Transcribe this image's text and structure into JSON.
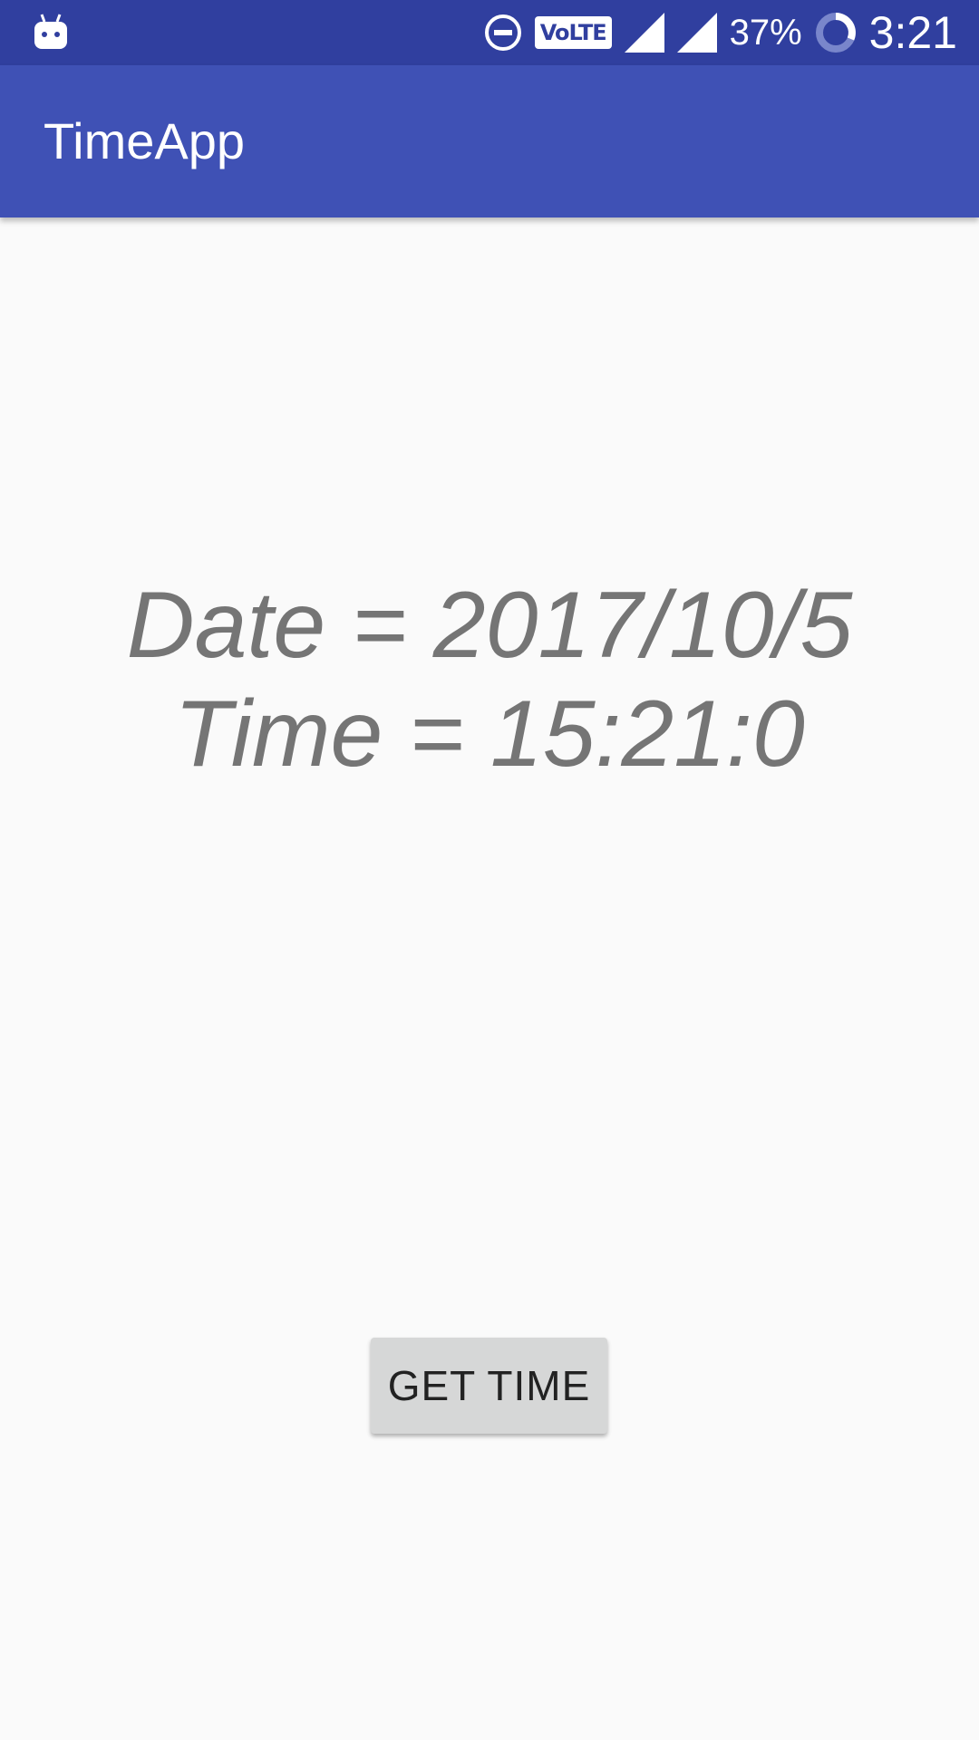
{
  "status_bar": {
    "app_icon": "android-robot-icon",
    "dnd_icon": "do-not-disturb-icon",
    "volte_label": "VoLTE",
    "signal_icons": [
      "signal-icon",
      "signal-icon"
    ],
    "battery_percent": "37%",
    "battery_icon": "battery-ring-icon",
    "clock": "3:21"
  },
  "app_bar": {
    "title": "TimeApp"
  },
  "main": {
    "date_line": "Date = 2017/10/5",
    "time_line": "Time = 15:21:0",
    "button_label": "GET TIME"
  },
  "colors": {
    "status_bar": "#303f9f",
    "app_bar": "#3f51b5",
    "background": "#fafafa",
    "text_gray": "#757575",
    "button": "#d6d7d7"
  }
}
